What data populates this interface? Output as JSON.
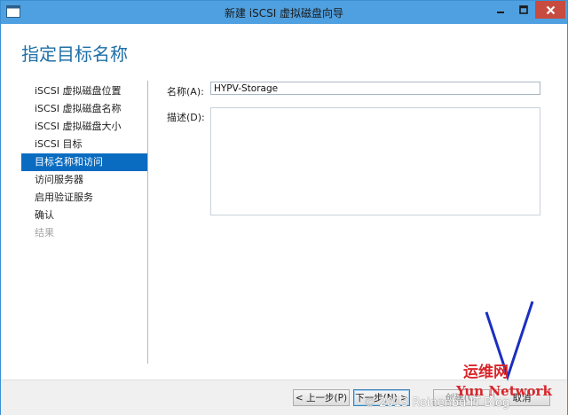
{
  "window": {
    "title": "新建 iSCSI 虚拟磁盘向导",
    "icon": "wizard-app-icon",
    "controls": {
      "minimize_icon": "minimize-icon",
      "maximize_icon": "maximize-icon",
      "close_icon": "close-icon"
    }
  },
  "page": {
    "title": "指定目标名称"
  },
  "nav": {
    "items": [
      {
        "label": "iSCSI 虚拟磁盘位置",
        "state": "normal"
      },
      {
        "label": "iSCSI 虚拟磁盘名称",
        "state": "normal"
      },
      {
        "label": "iSCSI 虚拟磁盘大小",
        "state": "normal"
      },
      {
        "label": "iSCSI 目标",
        "state": "normal"
      },
      {
        "label": "目标名称和访问",
        "state": "active"
      },
      {
        "label": "访问服务器",
        "state": "normal"
      },
      {
        "label": "启用验证服务",
        "state": "normal"
      },
      {
        "label": "确认",
        "state": "normal"
      },
      {
        "label": "结果",
        "state": "disabled"
      }
    ]
  },
  "form": {
    "name_label": "名称(A):",
    "name_value": "HYPV-Storage",
    "description_label": "描述(D):",
    "description_value": ""
  },
  "buttons": {
    "previous": "< 上一步(P)",
    "next": "下一步(N) >",
    "create": "创建(C)",
    "cancel": "取消"
  },
  "watermark": {
    "logo_text": "运维网",
    "logo_brand": "Yun Network",
    "copyright": "© 2013 Reinenbu IT Blog"
  },
  "colors": {
    "titlebar": "#4fa0e0",
    "close_button": "#c74b3f",
    "accent": "#0a6cc1",
    "page_title": "#1e6fa8",
    "watermark_red": "#d8262b",
    "watermark_blue": "#1b2fbf"
  }
}
